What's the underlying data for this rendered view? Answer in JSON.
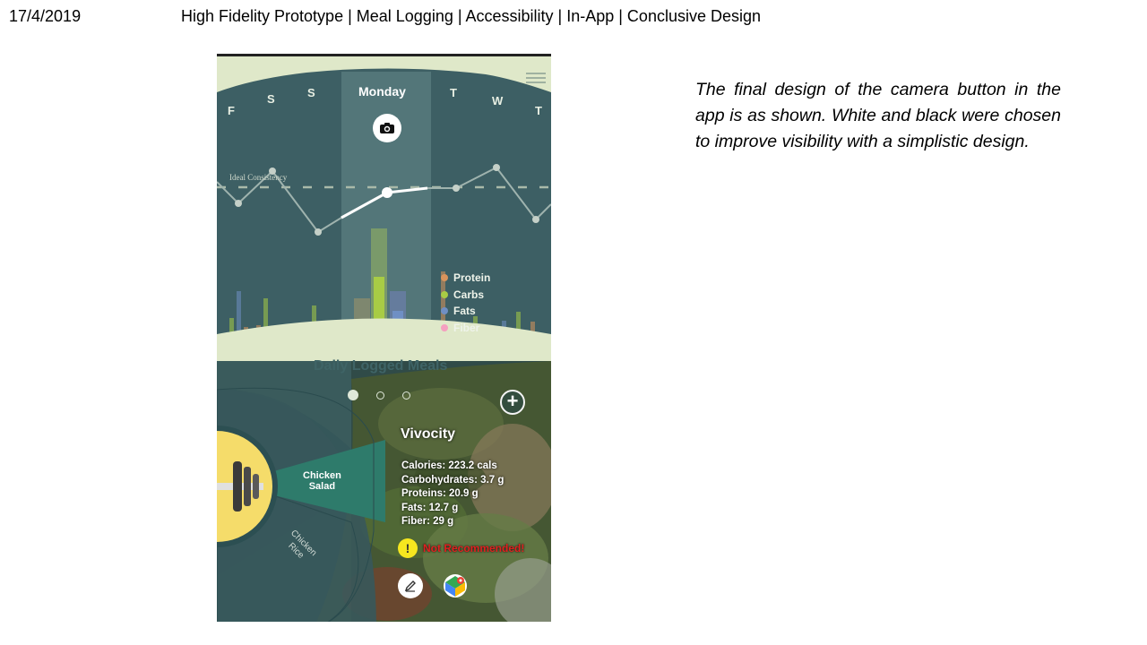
{
  "slide": {
    "date": "17/4/2019",
    "title": "High Fidelity Prototype | Meal Logging | Accessibility | In-App  | Conclusive Design",
    "caption": "The final design of the camera button in the app is as shown. White and black were chosen to improve visibility with a simplistic design."
  },
  "app": {
    "days": [
      "F",
      "S",
      "S",
      "Monday",
      "T",
      "W",
      "T"
    ],
    "active_day": "Monday",
    "trend_label": "Ideal Consistency",
    "legend": [
      {
        "label": "Protein",
        "color": "#d9945c"
      },
      {
        "label": "Carbs",
        "color": "#a8cc45"
      },
      {
        "label": "Fats",
        "color": "#6f8fc4"
      },
      {
        "label": "Fiber",
        "color": "#f59fc0"
      }
    ],
    "section_title": "Daily Logged Meals",
    "meal_wheel": {
      "selected": "Chicken Salad",
      "selected_line1": "Chicken",
      "selected_line2": "Salad",
      "other_line1": "Chicken",
      "other_line2": "Rice"
    },
    "vendor": "Vivocity",
    "nutrition": {
      "calories": "Calories: 223.2 cals",
      "carbs": "Carbohydrates: 3.7 g",
      "proteins": "Proteins: 20.9 g",
      "fats": "Fats: 12.7 g",
      "fiber": "Fiber: 29 g"
    },
    "warning": "Not Recommended!",
    "icons": {
      "camera": "camera-icon",
      "add": "plus-circle-icon",
      "edit": "pencil-icon",
      "map": "map-pin-icon",
      "menu": "hamburger-icon"
    }
  }
}
